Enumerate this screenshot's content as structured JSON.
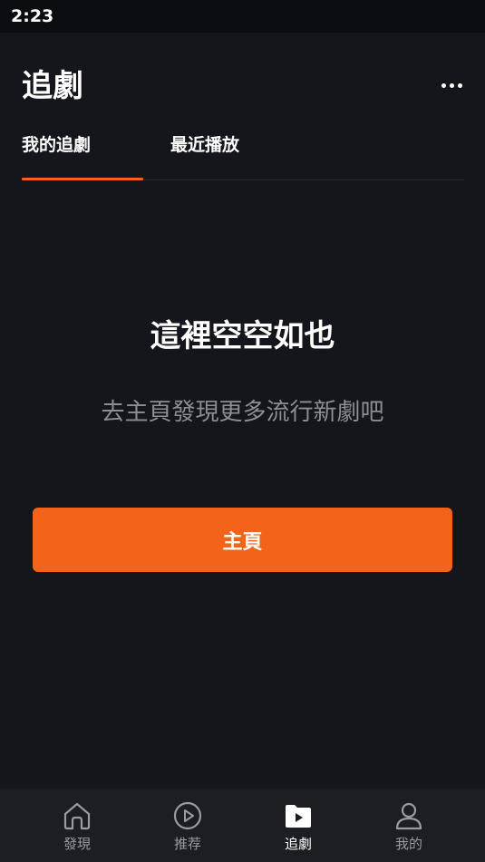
{
  "status_bar": {
    "time": "2:23"
  },
  "header": {
    "title": "追劇"
  },
  "tabs": [
    {
      "label": "我的追劇",
      "active": true
    },
    {
      "label": "最近播放",
      "active": false
    }
  ],
  "empty_state": {
    "title": "這裡空空如也",
    "subtitle": "去主頁發現更多流行新劇吧",
    "button_label": "主頁"
  },
  "bottom_nav": [
    {
      "label": "發現",
      "icon": "home-icon",
      "active": false
    },
    {
      "label": "推荐",
      "icon": "play-circle-icon",
      "active": false
    },
    {
      "label": "追劇",
      "icon": "folder-play-icon",
      "active": true
    },
    {
      "label": "我的",
      "icon": "user-icon",
      "active": false
    }
  ],
  "colors": {
    "accent": "#f4631a",
    "background": "#15161b",
    "nav_background": "#1d1e22",
    "muted_text": "#8d8e93"
  }
}
